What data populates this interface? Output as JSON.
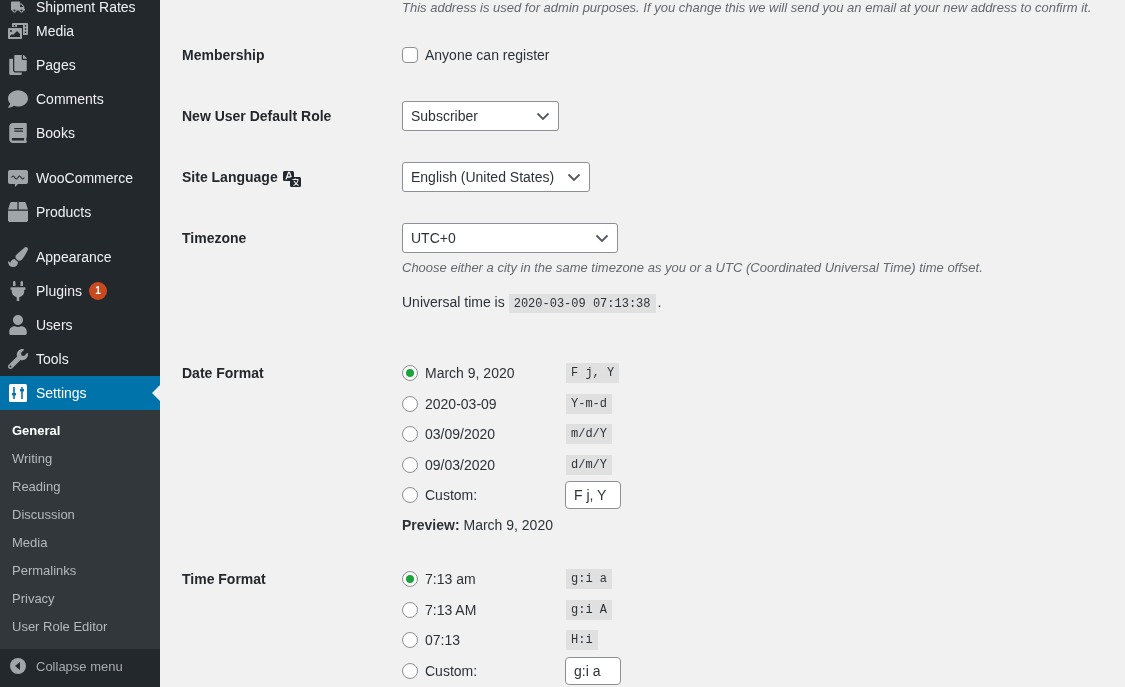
{
  "sidebar": {
    "groups": [
      {
        "items": [
          {
            "label": "Shipment Rates",
            "selected": false
          },
          {
            "label": "Media",
            "selected": false
          },
          {
            "label": "Pages",
            "selected": false
          },
          {
            "label": "Comments",
            "selected": false
          },
          {
            "label": "Books",
            "selected": false
          }
        ]
      },
      {
        "items": [
          {
            "label": "WooCommerce",
            "selected": false
          },
          {
            "label": "Products",
            "selected": false
          }
        ]
      },
      {
        "items": [
          {
            "label": "Appearance",
            "selected": false
          },
          {
            "label": "Plugins",
            "selected": false,
            "badge": "1"
          },
          {
            "label": "Users",
            "selected": false
          },
          {
            "label": "Tools",
            "selected": false
          },
          {
            "label": "Settings",
            "selected": true,
            "submenu": [
              {
                "label": "General",
                "selected": true
              },
              {
                "label": "Writing",
                "selected": false
              },
              {
                "label": "Reading",
                "selected": false
              },
              {
                "label": "Discussion",
                "selected": false
              },
              {
                "label": "Media",
                "selected": false
              },
              {
                "label": "Permalinks",
                "selected": false
              },
              {
                "label": "Privacy",
                "selected": false
              },
              {
                "label": "User Role Editor",
                "selected": false
              }
            ]
          }
        ]
      }
    ],
    "collapse_label": "Collapse menu"
  },
  "form": {
    "top_note": "This address is used for admin purposes. If you change this we will send you an email at your new address to confirm it.",
    "rows": [
      {
        "kind": "checkbox",
        "label": "Membership",
        "option": "Anyone can register",
        "checked": false
      },
      {
        "kind": "select",
        "label": "New User Default Role",
        "value": "Subscriber"
      },
      {
        "kind": "select",
        "label": "Site Language",
        "value": "English (United States)",
        "label_icon": true
      },
      {
        "kind": "select",
        "label": "Timezone",
        "value": "UTC+0",
        "hint": "Choose either a city in the same timezone as you or a UTC (Coordinated Universal Time) time offset.",
        "time_label": "Universal time is",
        "time_value": "2020-03-09 07:13:38",
        "time_suffix": "."
      },
      {
        "kind": "radio",
        "label": "Date Format",
        "options": [
          {
            "kind": "preset",
            "label": "March 9, 2020",
            "code": "F j, Y",
            "selected": true
          },
          {
            "kind": "preset",
            "label": "2020-03-09",
            "code": "Y-m-d",
            "selected": false
          },
          {
            "kind": "preset",
            "label": "03/09/2020",
            "code": "m/d/Y",
            "selected": false
          },
          {
            "kind": "preset",
            "label": "09/03/2020",
            "code": "d/m/Y",
            "selected": false
          },
          {
            "kind": "custom",
            "label": "Custom:",
            "value": "F j, Y",
            "selected": false
          }
        ],
        "preview": "**Preview:** March 9, 2020"
      },
      {
        "kind": "radio",
        "label": "Time Format",
        "options": [
          {
            "kind": "preset",
            "label": "7:13 am",
            "code": "g:i a",
            "selected": true
          },
          {
            "kind": "preset",
            "label": "7:13 AM",
            "code": "g:i A",
            "selected": false
          },
          {
            "kind": "preset",
            "label": "07:13",
            "code": "H:i",
            "selected": false
          },
          {
            "kind": "custom",
            "label": "Custom:",
            "value": "g:i a",
            "selected": false
          }
        ]
      }
    ]
  }
}
